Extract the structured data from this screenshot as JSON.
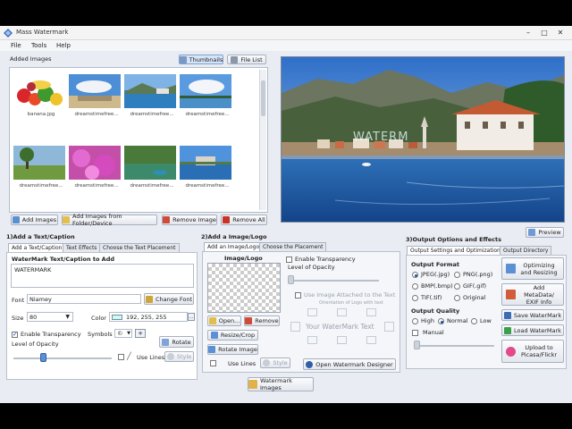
{
  "app": {
    "title": "Mass Watermark"
  },
  "menu": [
    "File",
    "Tools",
    "Help"
  ],
  "images": {
    "header": "Added Images",
    "view_thumbnails": "Thumbnails",
    "view_file_list": "File List",
    "items": [
      {
        "name": "banana.jpg"
      },
      {
        "name": "dreamstimefree..."
      },
      {
        "name": "dreamstimefree..."
      },
      {
        "name": "dreamstimefree..."
      },
      {
        "name": "dreamstimefree..."
      },
      {
        "name": "dreamstimefree..."
      },
      {
        "name": "dreamstimefree..."
      },
      {
        "name": "dreamstimefree..."
      }
    ],
    "add_images": "Add Images",
    "add_folder": "Add Images from Folder/Device",
    "remove_image": "Remove Image",
    "remove_all": "Remove All"
  },
  "preview": {
    "button": "Preview",
    "watermark_overlay": "WATERM"
  },
  "section1": {
    "title": "1)Add a Text/Caption",
    "tabs": [
      "Add a Text/Caption",
      "Text Effects",
      "Choose the Text Placement"
    ],
    "heading": "WaterMark Text/Caption to Add",
    "text_value": "WATERMARK",
    "font_label": "Font",
    "font_value": "Niamey",
    "change_font": "Change Font",
    "size_label": "Size",
    "size_value": "80",
    "color_label": "Color",
    "color_value": "192, 255, 255",
    "color_swatch": "#c0ffff",
    "enable_transparency": "Enable Transparency",
    "symbols_label": "Symbols",
    "symbols_value": "©",
    "rotate": "Rotate",
    "opacity_label": "Level of Opacity",
    "opacity_level": 0.3,
    "use_lines": "Use Lines",
    "style": "Style"
  },
  "section2": {
    "title": "2)Add a Image/Logo",
    "tabs": [
      "Add an Image/Logo",
      "Choose the Placement"
    ],
    "image_logo_label": "Image/Logo",
    "open": "Open...",
    "remove": "Remove",
    "resize_crop": "Resize/Crop",
    "rotate_image": "Rotate Image",
    "use_lines": "Use Lines",
    "style": "Style",
    "enable_transparency": "Enable Transparency",
    "opacity_label": "Level of Opacity",
    "use_attached": "Use Image Attached to the Text",
    "orientation": "Orientation of Logo with text",
    "your_text": "Your WaterMark Text",
    "open_designer": "Open Watermark Designer"
  },
  "section3": {
    "title": "3)Output Options and Effects",
    "tabs": [
      "Output Settings and Optimization",
      "Output Directory"
    ],
    "format_label": "Output Format",
    "formats": [
      "JPEG(.jpg)",
      "PNG(.png)",
      "BMP(.bmp)",
      "GIF(.gif)",
      "TIF(.tif)",
      "Original"
    ],
    "quality_label": "Output Quality",
    "qualities": [
      "High",
      "Normal",
      "Low"
    ],
    "manual": "Manual",
    "buttons": [
      "Optimizing and Resizing",
      "Add MetaData/ EXIF Info",
      "Save WaterMark",
      "Load WaterMark",
      "Upload to Picasa/Flickr"
    ]
  },
  "watermark_images": "Watermark Images"
}
